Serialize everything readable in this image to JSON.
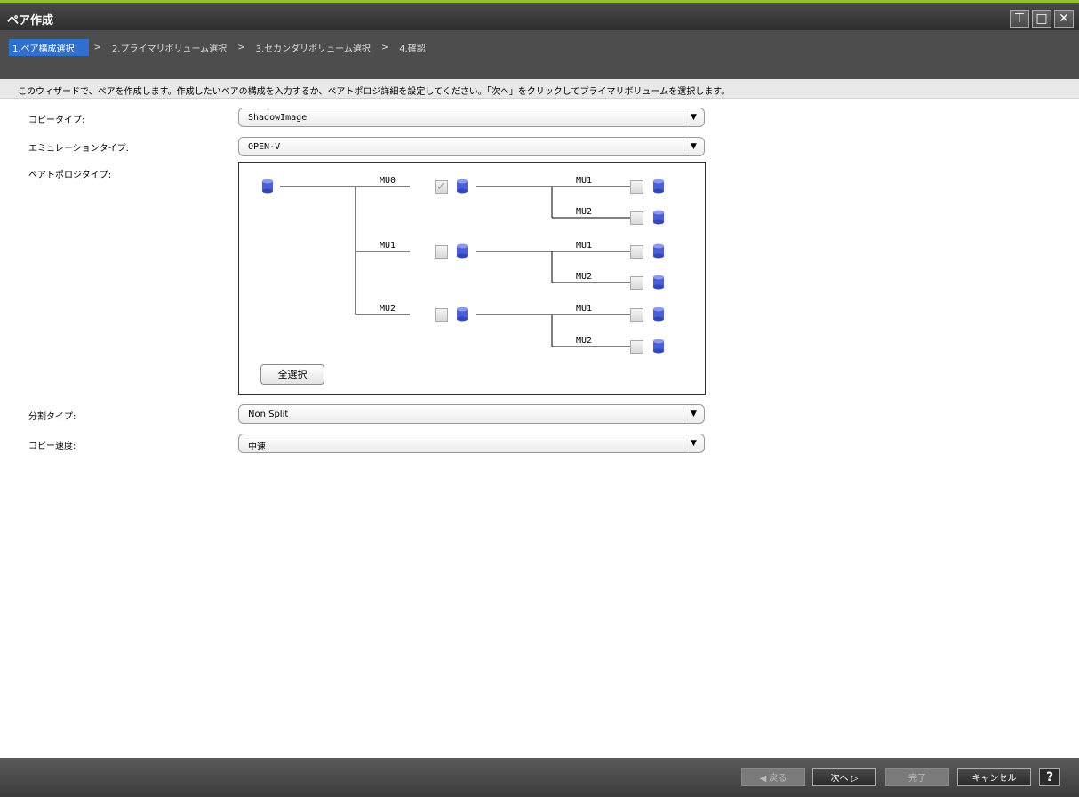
{
  "window": {
    "title": "ペア作成"
  },
  "wizard": {
    "steps": [
      "1.ペア構成選択",
      "2.プライマリボリューム選択",
      "3.セカンダリボリューム選択",
      "4.確認"
    ],
    "separator": ">",
    "active_step": 0,
    "description": "このウィザードで、ペアを作成します。作成したいペアの構成を入力するか、ペアトポロジ詳細を設定してください。「次へ」をクリックしてプライマリボリュームを選択します。"
  },
  "form": {
    "copy_type": {
      "label": "コピータイプ:",
      "value": "ShadowImage"
    },
    "emulation_type": {
      "label": "エミュレーションタイプ:",
      "value": "OPEN-V"
    },
    "topology": {
      "label": "ペアトポロジタイプ:",
      "level1": [
        {
          "mu": "MU0",
          "checked": true,
          "children": [
            {
              "mu": "MU1",
              "checked": false
            },
            {
              "mu": "MU2",
              "checked": false
            }
          ]
        },
        {
          "mu": "MU1",
          "checked": false,
          "children": [
            {
              "mu": "MU1",
              "checked": false
            },
            {
              "mu": "MU2",
              "checked": false
            }
          ]
        },
        {
          "mu": "MU2",
          "checked": false,
          "children": [
            {
              "mu": "MU1",
              "checked": false
            },
            {
              "mu": "MU2",
              "checked": false
            }
          ]
        }
      ],
      "select_all_label": "全選択"
    },
    "split_type": {
      "label": "分割タイプ:",
      "value": "Non Split"
    },
    "copy_speed": {
      "label": "コピー速度:",
      "value": "中速"
    }
  },
  "footer": {
    "back": "◀ 戻る",
    "next": "次へ ▷",
    "finish": "完了",
    "cancel": "キャンセル",
    "help": "?"
  },
  "colors": {
    "accent": "#8fc31f",
    "active_step": "#2f6fd0",
    "disk": "#4a5fd8"
  }
}
